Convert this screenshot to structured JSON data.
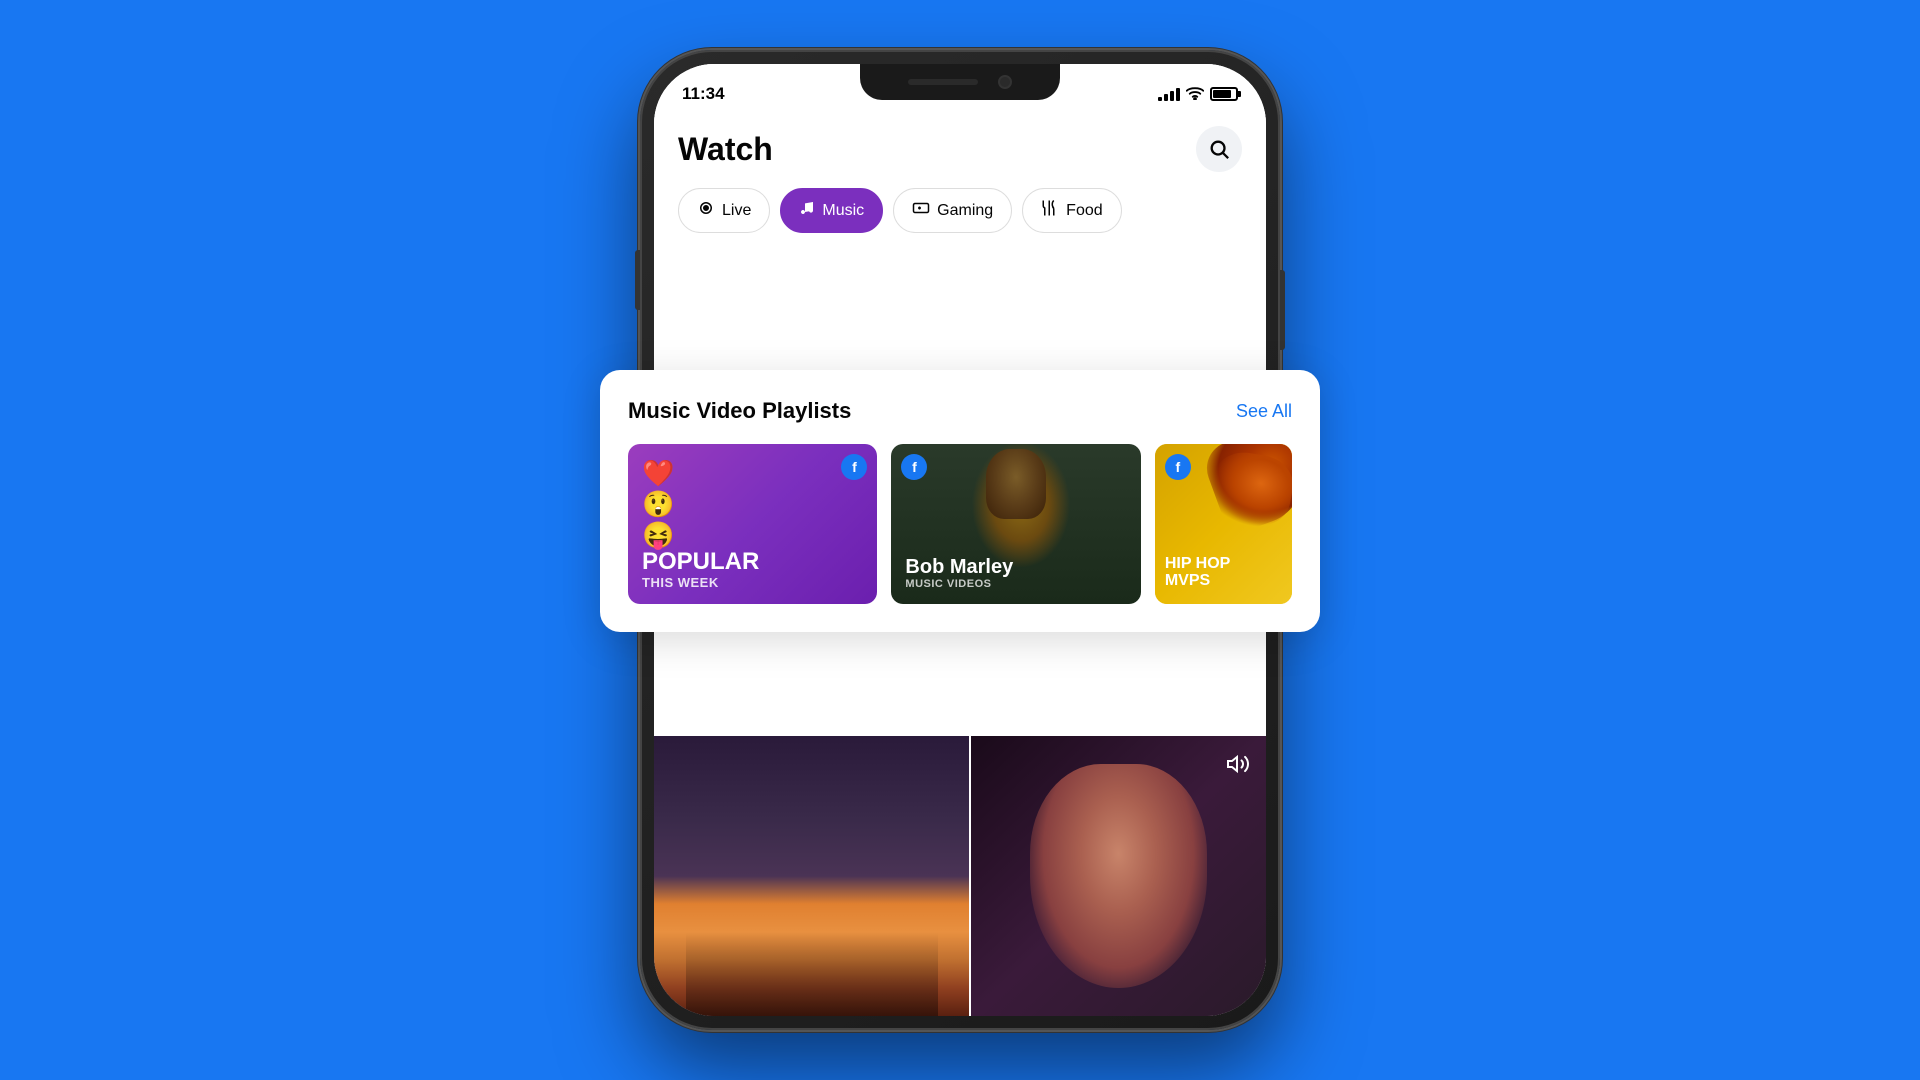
{
  "background_color": "#1877F2",
  "phone": {
    "status_bar": {
      "time": "11:34",
      "signal_bars": 4,
      "wifi": true,
      "battery_level": 80
    },
    "header": {
      "title": "Watch",
      "search_aria": "Search"
    },
    "category_pills": [
      {
        "id": "live",
        "label": "Live",
        "icon": "📷",
        "active": false
      },
      {
        "id": "music",
        "label": "Music",
        "icon": "♪",
        "active": true
      },
      {
        "id": "gaming",
        "label": "Gaming",
        "icon": "🎮",
        "active": false
      },
      {
        "id": "food",
        "label": "Food",
        "icon": "🍴",
        "active": false
      }
    ],
    "floating_card": {
      "title": "Music Video Playlists",
      "see_all_label": "See All",
      "playlists": [
        {
          "id": "popular",
          "label_main": "POPULAR",
          "label_sub": "THIS WEEK",
          "emojis": "❤️\n😲\n😝",
          "bg_type": "purple"
        },
        {
          "id": "bobmarley",
          "label_main": "Bob Marley",
          "label_sub": "MUSIC VIDEOS",
          "bg_type": "dark_green"
        },
        {
          "id": "hiphop",
          "label_main": "HIP HOP\nMVPs",
          "label_sub": "",
          "bg_type": "yellow"
        }
      ]
    },
    "video_bottom": {
      "sound_icon_visible": true
    }
  }
}
